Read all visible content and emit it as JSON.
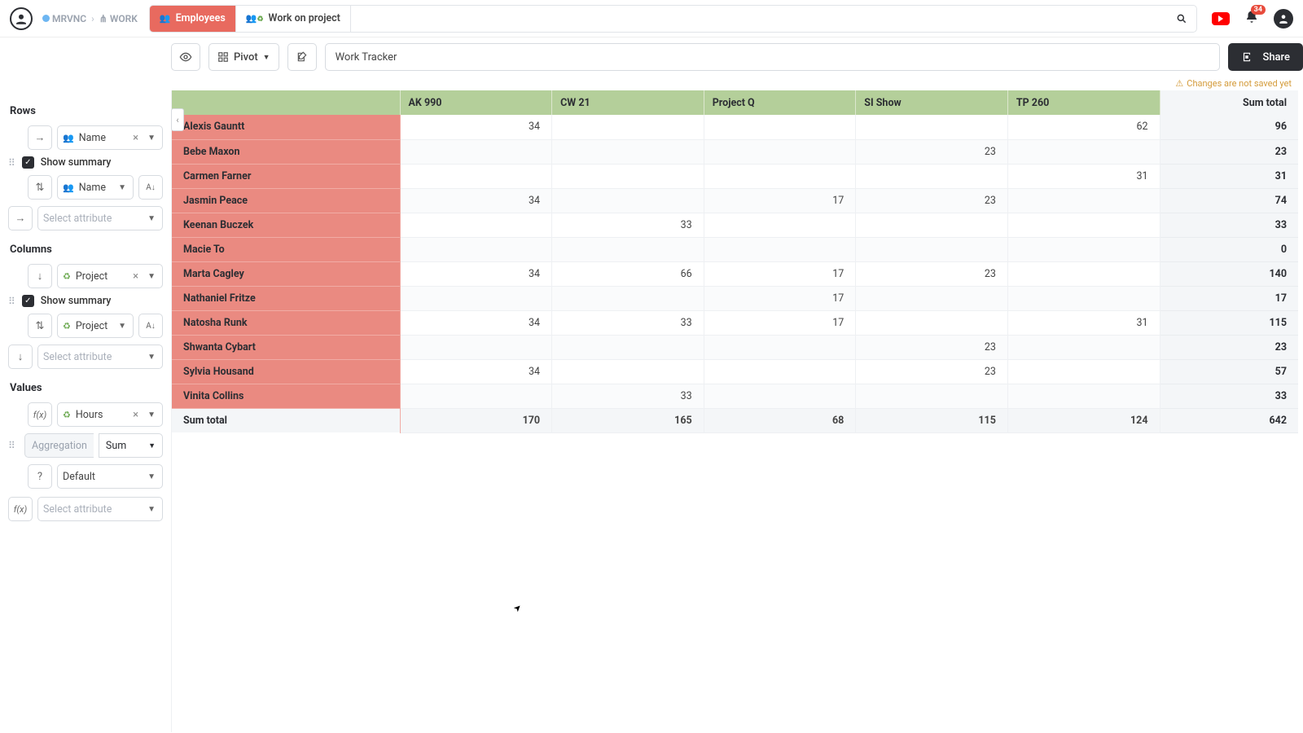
{
  "header": {
    "breadcrumbs": [
      "MRVNC",
      "WORK"
    ],
    "tabs": [
      {
        "label": "Employees",
        "active": true
      },
      {
        "label": "Work on project",
        "active": false
      }
    ],
    "notification_count": "34"
  },
  "toolbar": {
    "view_mode": "Pivot",
    "title_value": "Work Tracker",
    "share_label": "Share",
    "warn_text": "Changes are not saved yet"
  },
  "sidebar": {
    "rows_label": "Rows",
    "columns_label": "Columns",
    "values_label": "Values",
    "show_summary_label": "Show summary",
    "select_attr_placeholder": "Select attribute",
    "aggregation_label": "Aggregation",
    "aggregation_value": "Sum",
    "format_value": "Default",
    "rows_attr": "Name",
    "rows_sort_attr": "Name",
    "cols_attr": "Project",
    "cols_sort_attr": "Project",
    "values_attr": "Hours"
  },
  "pivot": {
    "sum_total_label": "Sum total",
    "columns": [
      "AK 990",
      "CW 21",
      "Project Q",
      "SI Show",
      "TP 260"
    ],
    "rows": [
      {
        "name": "Alexis Gauntt",
        "cells": [
          "34",
          "",
          "",
          "",
          "62"
        ],
        "sum": "96"
      },
      {
        "name": "Bebe Maxon",
        "cells": [
          "",
          "",
          "",
          "23",
          ""
        ],
        "sum": "23"
      },
      {
        "name": "Carmen Farner",
        "cells": [
          "",
          "",
          "",
          "",
          "31"
        ],
        "sum": "31"
      },
      {
        "name": "Jasmin Peace",
        "cells": [
          "34",
          "",
          "17",
          "23",
          ""
        ],
        "sum": "74"
      },
      {
        "name": "Keenan Buczek",
        "cells": [
          "",
          "33",
          "",
          "",
          ""
        ],
        "sum": "33"
      },
      {
        "name": "Macie To",
        "cells": [
          "",
          "",
          "",
          "",
          ""
        ],
        "sum": "0"
      },
      {
        "name": "Marta Cagley",
        "cells": [
          "34",
          "66",
          "17",
          "23",
          ""
        ],
        "sum": "140"
      },
      {
        "name": "Nathaniel Fritze",
        "cells": [
          "",
          "",
          "17",
          "",
          ""
        ],
        "sum": "17"
      },
      {
        "name": "Natosha Runk",
        "cells": [
          "34",
          "33",
          "17",
          "",
          "31"
        ],
        "sum": "115"
      },
      {
        "name": "Shwanta Cybart",
        "cells": [
          "",
          "",
          "",
          "23",
          ""
        ],
        "sum": "23"
      },
      {
        "name": "Sylvia Housand",
        "cells": [
          "34",
          "",
          "",
          "23",
          ""
        ],
        "sum": "57"
      },
      {
        "name": "Vinita Collins",
        "cells": [
          "",
          "33",
          "",
          "",
          ""
        ],
        "sum": "33"
      }
    ],
    "col_totals": [
      "170",
      "165",
      "68",
      "115",
      "124"
    ],
    "grand_total": "642"
  }
}
